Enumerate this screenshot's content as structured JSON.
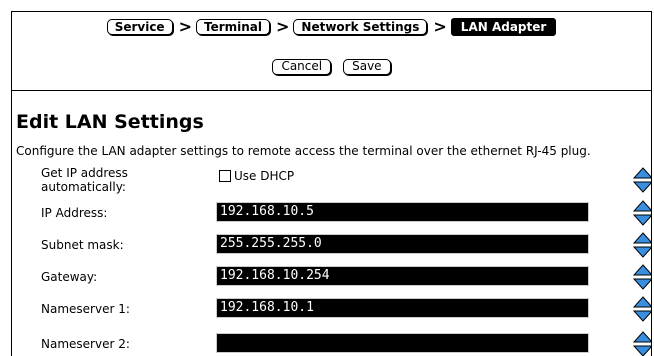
{
  "breadcrumb": {
    "items": [
      "Service",
      "Terminal",
      "Network Settings"
    ],
    "current": "LAN Adapter",
    "separator": ">"
  },
  "actions": {
    "cancel_label": "Cancel",
    "save_label": "Save"
  },
  "page": {
    "title": "Edit LAN Settings",
    "description": "Configure the LAN adapter settings to remote access the terminal over the ethernet RJ-45 plug."
  },
  "form": {
    "dhcp": {
      "label_line1": "Get IP address",
      "label_line2": "automatically:",
      "checkbox_label": "Use DHCP",
      "checked": false
    },
    "ip_address": {
      "label": "IP Address:",
      "value": "192.168.10.5"
    },
    "subnet_mask": {
      "label": "Subnet mask:",
      "value": "255.255.255.0"
    },
    "gateway": {
      "label": "Gateway:",
      "value": "192.168.10.254"
    },
    "nameserver1": {
      "label": "Nameserver 1:",
      "value": "192.168.10.1"
    },
    "nameserver2": {
      "label": "Nameserver 2:",
      "value": ""
    }
  },
  "colors": {
    "stepper_fill": "#3a8ee0",
    "field_bg": "#000000",
    "field_text": "#ffffff"
  },
  "icons": {
    "stepper": "up-down-arrows-icon"
  }
}
